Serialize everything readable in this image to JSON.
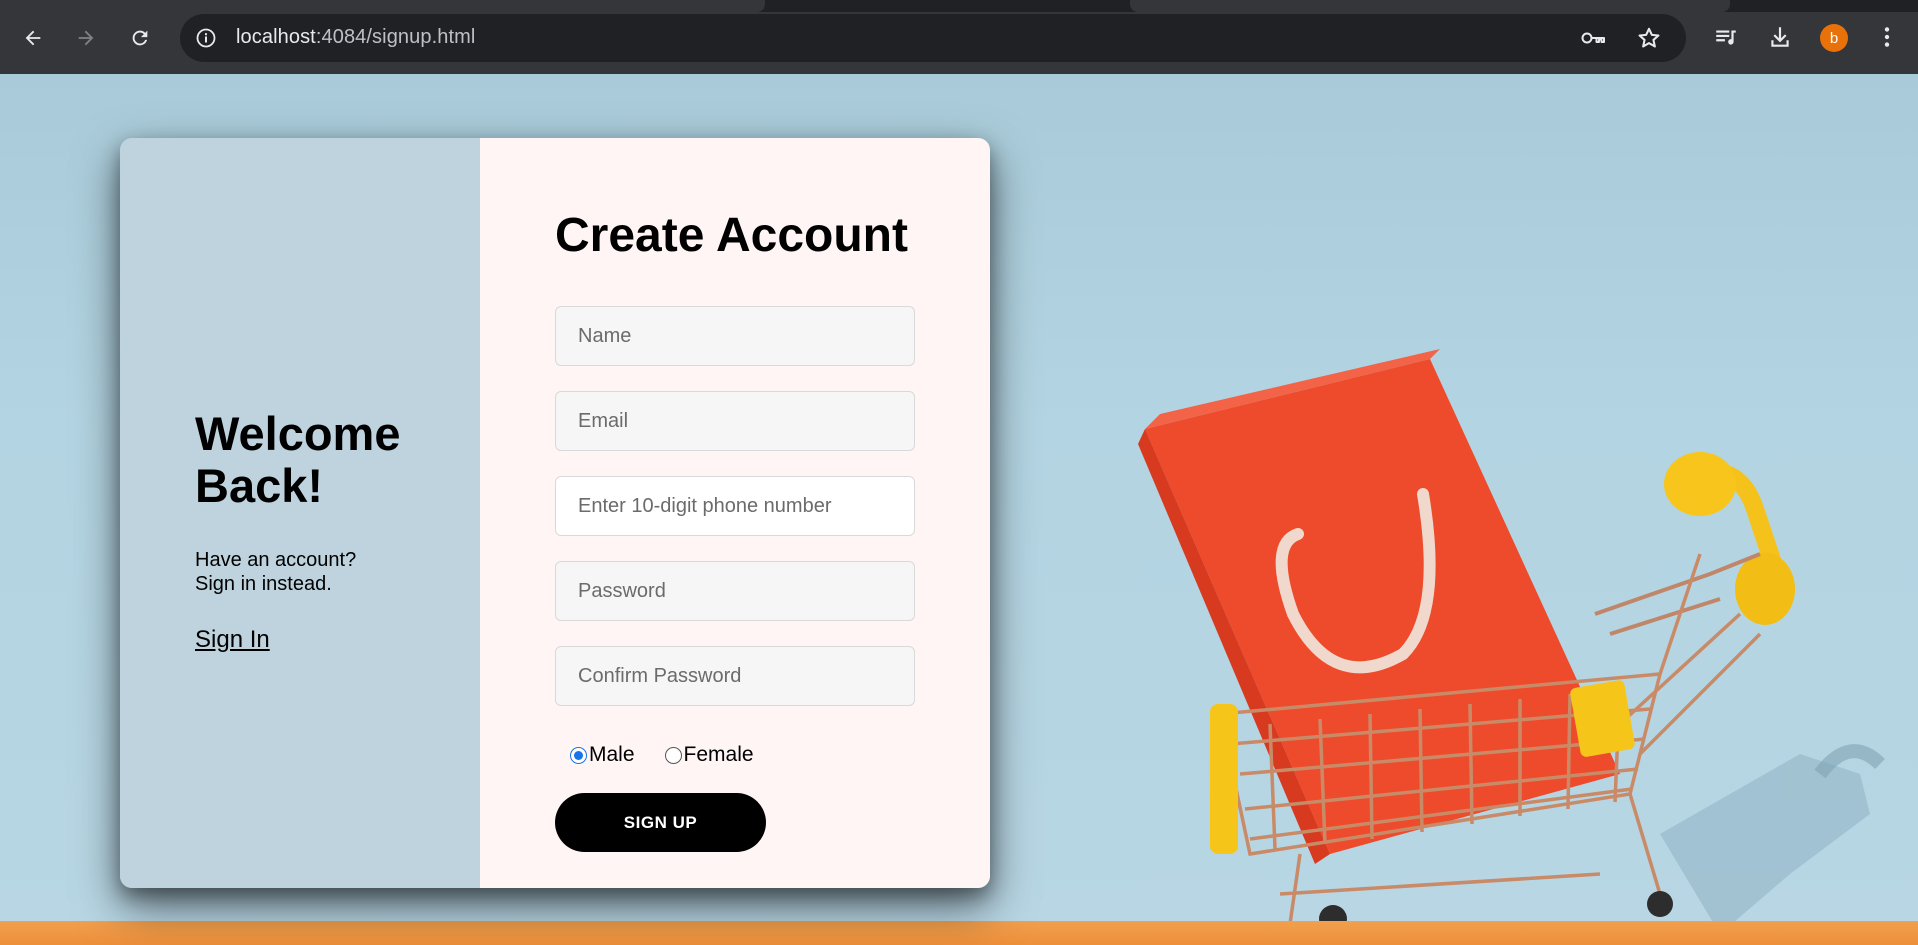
{
  "browser": {
    "url_host": "localhost",
    "url_rest": ":4084/signup.html",
    "profile_initial": "b",
    "colors": {
      "chrome": "#35363a",
      "omnibox": "#202124",
      "avatar": "#e8710a"
    },
    "icons": [
      "back-arrow-icon",
      "forward-arrow-icon",
      "reload-icon",
      "site-info-icon",
      "password-key-icon",
      "bookmark-star-icon",
      "media-queue-icon",
      "download-icon",
      "kebab-menu-icon"
    ]
  },
  "welcome_panel": {
    "heading": "Welcome Back!",
    "subtitle_line1": "Have an account?",
    "subtitle_line2": "Sign in instead.",
    "signin_link": "Sign In",
    "background": "#bed3de"
  },
  "signup_form": {
    "title": "Create Account",
    "fields": {
      "name_placeholder": "Name",
      "email_placeholder": "Email",
      "phone_placeholder": "Enter 10-digit phone number",
      "password_placeholder": "Password",
      "confirm_placeholder": "Confirm Password"
    },
    "gender": {
      "options": [
        "Male",
        "Female"
      ],
      "selected": "Male"
    },
    "submit_label": "SIGN UP",
    "background": "#fff5f5"
  }
}
